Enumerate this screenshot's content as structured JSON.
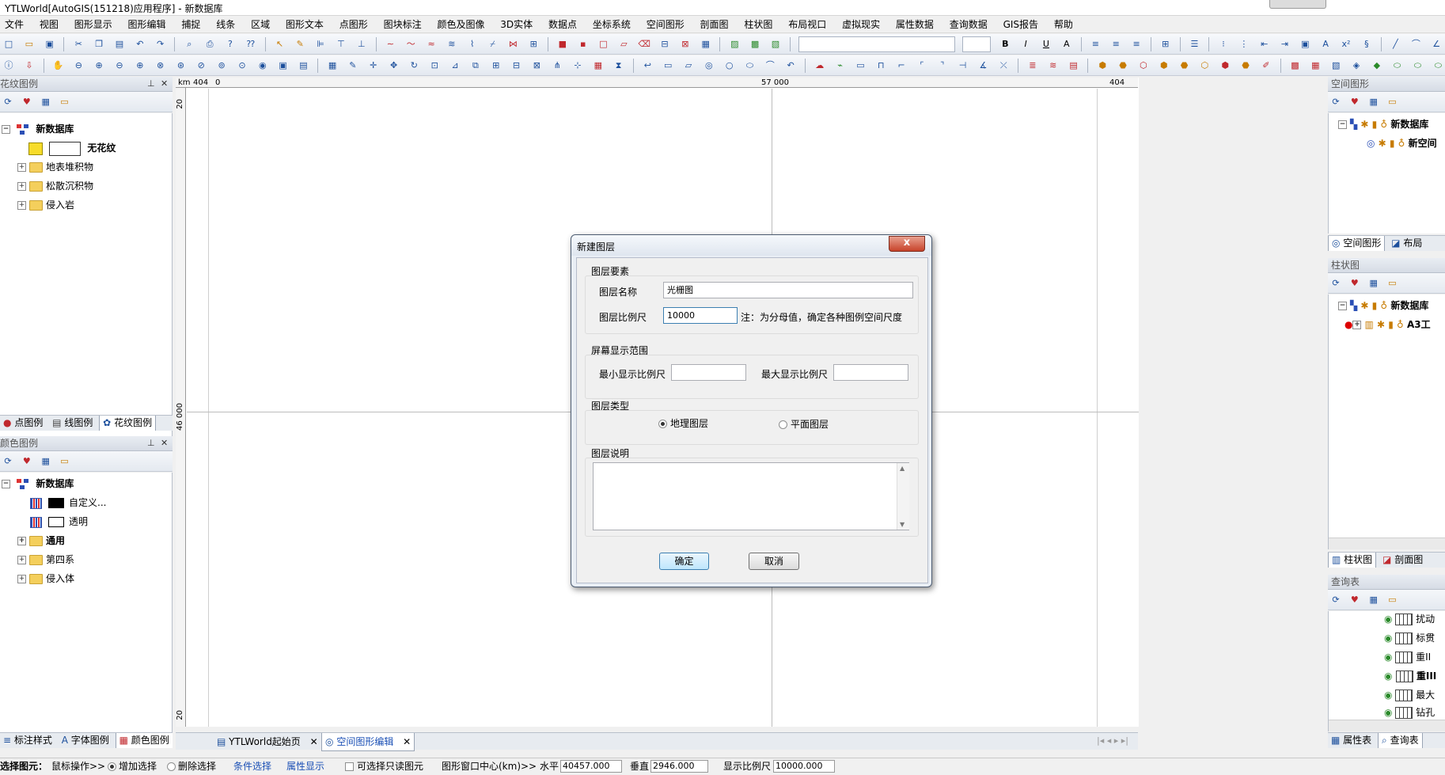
{
  "app": {
    "title": "YTLWorld[AutoGIS(151218)应用程序] - 新数据库"
  },
  "menu": [
    "文件",
    "视图",
    "图形显示",
    "图形编辑",
    "捕捉",
    "线条",
    "区域",
    "图形文本",
    "点图形",
    "图块标注",
    "颜色及图像",
    "3D实体",
    "数据点",
    "坐标系统",
    "空间图形",
    "剖面图",
    "柱状图",
    "布局视口",
    "虚拟现实",
    "属性数据",
    "查询数据",
    "GIS报告",
    "帮助"
  ],
  "left_top_panel": {
    "title": "花纹图例",
    "root": "新数据库",
    "selected_item": "无花纹",
    "items": [
      "地表堆积物",
      "松散沉积物",
      "侵入岩"
    ],
    "tabs": [
      "点图例",
      "线图例",
      "花纹图例"
    ]
  },
  "left_bottom_panel": {
    "title": "颜色图例",
    "root": "新数据库",
    "color_items": [
      {
        "label": "自定义...",
        "color": "#000000"
      },
      {
        "label": "透明",
        "color": "#ffffff"
      }
    ],
    "folders": [
      "通用",
      "第四系",
      "侵入体"
    ],
    "tabs": [
      "标注样式",
      "字体图例",
      "颜色图例"
    ]
  },
  "canvas": {
    "ruler_unit": "km",
    "ruler_top_left": "404",
    "ruler_top_zero": "0",
    "ruler_top_mid": "57 000",
    "ruler_top_right": "404",
    "ruler_left_top": "20",
    "ruler_left_mid": "46 000",
    "ruler_left_bottom": "20"
  },
  "doc_tabs": [
    "YTLWorld起始页",
    "空间图形编辑"
  ],
  "right_panel_1": {
    "title": "空间图形",
    "root": "新数据库",
    "child": "新空间",
    "tabs": [
      "空间图形",
      "布局"
    ]
  },
  "right_panel_2": {
    "title": "柱状图",
    "root": "新数据库",
    "child": "A3工",
    "tabs": [
      "柱状图",
      "剖面图"
    ]
  },
  "right_panel_3": {
    "title": "查询表",
    "items": [
      "扰动",
      "标贯",
      "重II",
      "重III",
      "最大",
      "钻孔"
    ],
    "tabs": [
      "属性表",
      "查询表"
    ]
  },
  "dialog": {
    "title": "新建图层",
    "close_label": "x",
    "group1": "图层要素",
    "name_label": "图层名称",
    "name_value": "光栅图",
    "scale_label": "图层比例尺",
    "scale_value": "10000",
    "scale_note": "注：为分母值，确定各种图例空间尺度",
    "group2": "屏幕显示范围",
    "min_scale_label": "最小显示比例尺",
    "max_scale_label": "最大显示比例尺",
    "min_scale_value": "",
    "max_scale_value": "",
    "group3": "图层类型",
    "type_geo": "地理图层",
    "type_plane": "平面图层",
    "type_selected": "地理图层",
    "group4": "图层说明",
    "description": "",
    "ok": "确定",
    "cancel": "取消"
  },
  "statusbar": {
    "select_label": "选择图元：",
    "mouse_op": "鼠标操作>>",
    "add_select": "增加选择",
    "remove_select": "删除选择",
    "cond_select": "条件选择",
    "attr_display": "属性显示",
    "readonly_select": "可选择只读图元",
    "window_center": "图形窗口中心(km)>>",
    "horizontal_label": "水平",
    "horizontal_value": "40457.000",
    "vertical_label": "垂直",
    "vertical_value": "2946.000",
    "scale_label": "显示比例尺",
    "scale_value": "10000.000"
  },
  "colors": {
    "toolbar_bg": "#e3e8f0",
    "dialog_bg": "#f0f0f0",
    "link": "#1a4fb5"
  }
}
